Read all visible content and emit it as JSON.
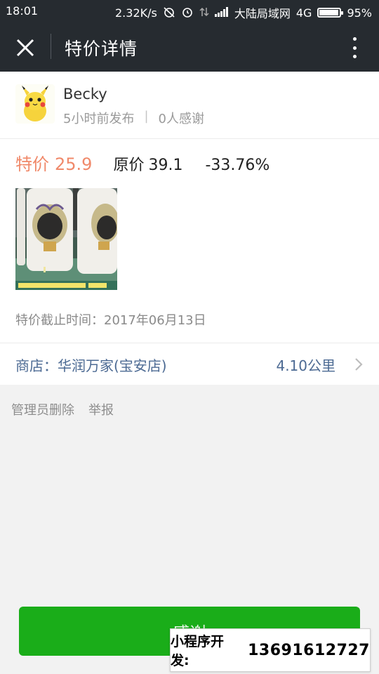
{
  "status_bar": {
    "time": "18:01",
    "speed": "2.32K/s",
    "carrier": "大陆局域网",
    "network": "4G",
    "battery": "95%",
    "battery_level": 0.95,
    "icons": [
      "alarm-off-icon",
      "alarm-icon",
      "data-arrows-icon",
      "signal-icon",
      "battery-icon"
    ]
  },
  "title_bar": {
    "title": "特价详情"
  },
  "post": {
    "username": "Becky",
    "posted": "5小时前发布",
    "separator": "|",
    "thanks_count": "0人感谢",
    "special_label": "特价",
    "special_price": "25.9",
    "original_label": "原价",
    "original_price": "39.1",
    "discount": "-33.76%",
    "deadline_label": "特价截止时间：",
    "deadline_value": "2017年06月13日",
    "shop_label": "商店：",
    "shop_name": "华润万家(宝安店)",
    "distance": "4.10公里"
  },
  "admin": {
    "delete": "管理员删除",
    "report": "举报"
  },
  "thank_button": "感谢",
  "watermark": {
    "label": "小程序开发:",
    "phone": "13691612727"
  },
  "colors": {
    "header_bg": "#262b30",
    "special_price": "#f0896a",
    "link_blue": "#4c6a93",
    "button_green": "#1aad19"
  }
}
